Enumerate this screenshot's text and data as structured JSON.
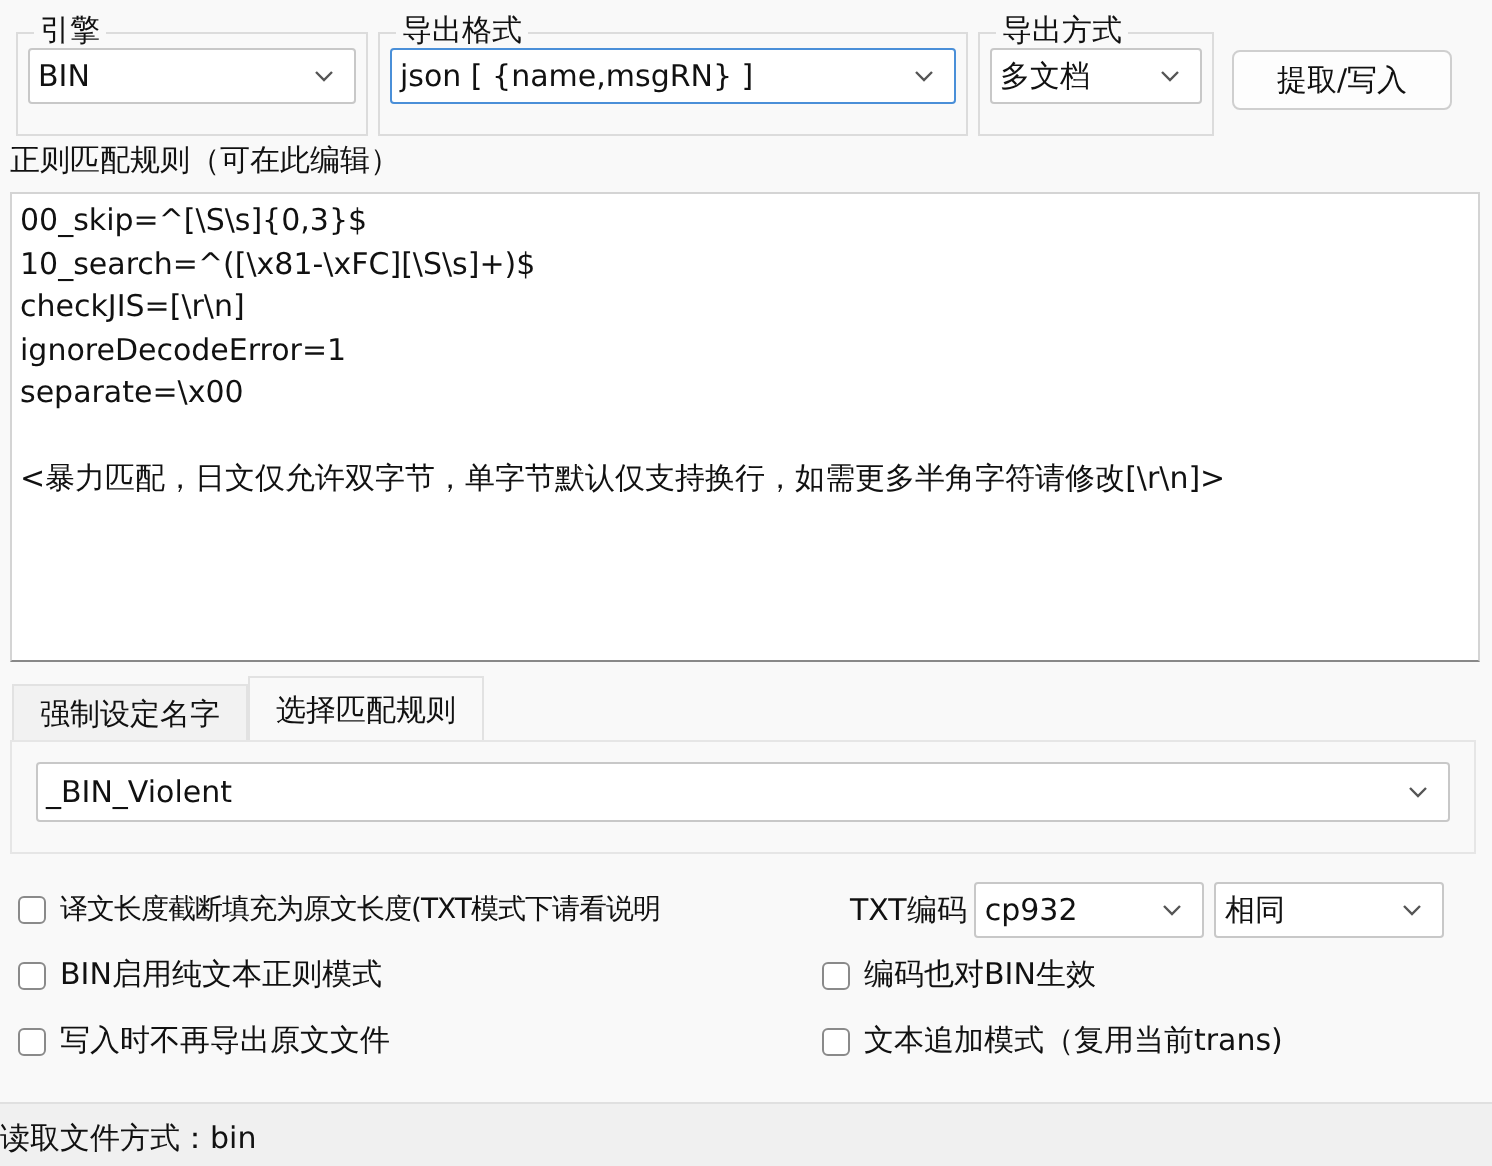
{
  "groups": [
    {
      "title": "引擎",
      "value": "BIN",
      "focused": false
    },
    {
      "title": "导出格式",
      "value": "json [ {name,msgRN} ]",
      "focused": true
    },
    {
      "title": "导出方式",
      "value": "多文档",
      "focused": false
    }
  ],
  "action_button": "提取/写入",
  "rules_label": "正则匹配规则（可在此编辑）",
  "rules_lines": [
    "00_skip=^[\\S\\s]{0,3}$",
    "10_search=^([\\x81-\\xFC][\\S\\s]+)$",
    "checkJIS=[\\r\\n]",
    "ignoreDecodeError=1",
    "separate=\\x00"
  ],
  "rules_note": "<暴力匹配，日文仅允许双字节，单字节默认仅支持换行，如需更多半角字符请修改[\\r\\n]>",
  "tabs": [
    {
      "label": "强制设定名字",
      "selected": false
    },
    {
      "label": "选择匹配规则",
      "selected": true
    }
  ],
  "rule_select": "_BIN_Violent",
  "options": [
    {
      "label": "译文长度截断填充为原文长度(TXT模式下请看说明",
      "checked": false
    },
    {
      "label": "BIN启用纯文本正则模式",
      "checked": false
    },
    {
      "label": "编码也对BIN生效",
      "checked": false
    },
    {
      "label": "写入时不再导出原文文件",
      "checked": false
    },
    {
      "label": "文本追加模式（复用当前trans)",
      "checked": false
    }
  ],
  "encoding": {
    "label": "TXT编码",
    "value": "cp932",
    "second_value": "相同"
  },
  "status_bar": "读取文件方式：bin"
}
